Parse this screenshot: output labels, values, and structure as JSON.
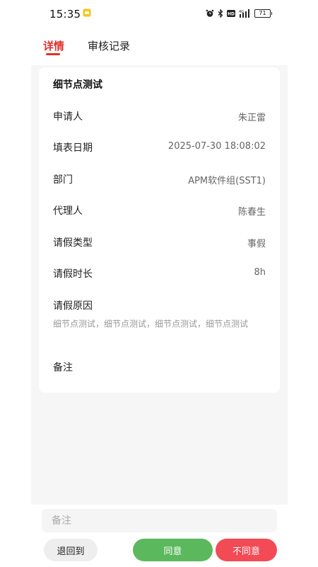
{
  "status": {
    "time": "15:35",
    "battery": "71"
  },
  "tabs": [
    {
      "label": "详情",
      "active": true
    },
    {
      "label": "审核记录",
      "active": false
    }
  ],
  "detail": {
    "title": "细节点测试",
    "rows": [
      {
        "label": "申请人",
        "value": "朱正雷"
      },
      {
        "label": "填表日期",
        "value": "2025-07-30 18:08:02"
      },
      {
        "label": "部门",
        "value": "APM软件组(SST1)"
      },
      {
        "label": "代理人",
        "value": "陈春生"
      },
      {
        "label": "请假类型",
        "value": "事假"
      },
      {
        "label": "请假时长",
        "value": "8h"
      }
    ],
    "reason_label": "请假原因",
    "reason_text": "细节点测试，细节点测试，细节点测试，细节点测试",
    "remark_label": "备注"
  },
  "footer": {
    "remark_placeholder": "备注",
    "back_label": "退回到",
    "agree_label": "同意",
    "reject_label": "不同意"
  },
  "colors": {
    "accent": "#e0302e",
    "agree": "#5cb85c",
    "reject": "#f24b55"
  }
}
